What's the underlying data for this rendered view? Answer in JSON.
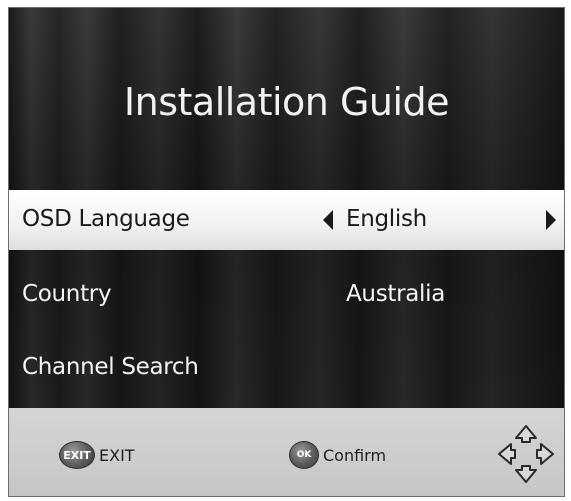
{
  "header": {
    "title": "Installation Guide"
  },
  "menu": {
    "items": [
      {
        "label": "OSD Language",
        "value": "English",
        "selected": true
      },
      {
        "label": "Country",
        "value": "Australia",
        "selected": false
      },
      {
        "label": "Channel Search",
        "value": "",
        "selected": false
      }
    ]
  },
  "footer": {
    "exit": {
      "icon_label": "EXIT",
      "label": "EXIT"
    },
    "confirm": {
      "icon_label": "OK",
      "label": "Confirm"
    },
    "dpad_icon": "dpad-arrows-icon"
  },
  "colors": {
    "highlight": "#ffffff",
    "footer": "#cfcfcf",
    "text": "#f4f4f4"
  }
}
